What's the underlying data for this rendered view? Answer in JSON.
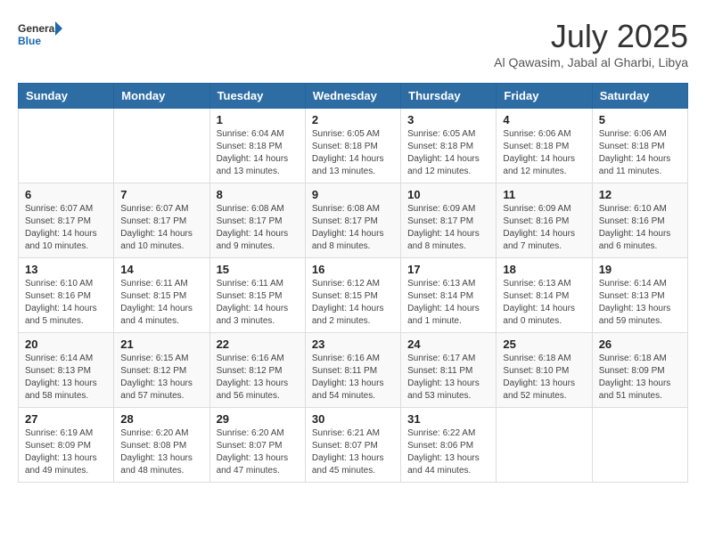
{
  "header": {
    "logo_line1": "General",
    "logo_line2": "Blue",
    "main_title": "July 2025",
    "sub_title": "Al Qawasim, Jabal al Gharbi, Libya"
  },
  "weekdays": [
    "Sunday",
    "Monday",
    "Tuesday",
    "Wednesday",
    "Thursday",
    "Friday",
    "Saturday"
  ],
  "weeks": [
    [
      {
        "day": "",
        "info": ""
      },
      {
        "day": "",
        "info": ""
      },
      {
        "day": "1",
        "info": "Sunrise: 6:04 AM\nSunset: 8:18 PM\nDaylight: 14 hours and 13 minutes."
      },
      {
        "day": "2",
        "info": "Sunrise: 6:05 AM\nSunset: 8:18 PM\nDaylight: 14 hours and 13 minutes."
      },
      {
        "day": "3",
        "info": "Sunrise: 6:05 AM\nSunset: 8:18 PM\nDaylight: 14 hours and 12 minutes."
      },
      {
        "day": "4",
        "info": "Sunrise: 6:06 AM\nSunset: 8:18 PM\nDaylight: 14 hours and 12 minutes."
      },
      {
        "day": "5",
        "info": "Sunrise: 6:06 AM\nSunset: 8:18 PM\nDaylight: 14 hours and 11 minutes."
      }
    ],
    [
      {
        "day": "6",
        "info": "Sunrise: 6:07 AM\nSunset: 8:17 PM\nDaylight: 14 hours and 10 minutes."
      },
      {
        "day": "7",
        "info": "Sunrise: 6:07 AM\nSunset: 8:17 PM\nDaylight: 14 hours and 10 minutes."
      },
      {
        "day": "8",
        "info": "Sunrise: 6:08 AM\nSunset: 8:17 PM\nDaylight: 14 hours and 9 minutes."
      },
      {
        "day": "9",
        "info": "Sunrise: 6:08 AM\nSunset: 8:17 PM\nDaylight: 14 hours and 8 minutes."
      },
      {
        "day": "10",
        "info": "Sunrise: 6:09 AM\nSunset: 8:17 PM\nDaylight: 14 hours and 8 minutes."
      },
      {
        "day": "11",
        "info": "Sunrise: 6:09 AM\nSunset: 8:16 PM\nDaylight: 14 hours and 7 minutes."
      },
      {
        "day": "12",
        "info": "Sunrise: 6:10 AM\nSunset: 8:16 PM\nDaylight: 14 hours and 6 minutes."
      }
    ],
    [
      {
        "day": "13",
        "info": "Sunrise: 6:10 AM\nSunset: 8:16 PM\nDaylight: 14 hours and 5 minutes."
      },
      {
        "day": "14",
        "info": "Sunrise: 6:11 AM\nSunset: 8:15 PM\nDaylight: 14 hours and 4 minutes."
      },
      {
        "day": "15",
        "info": "Sunrise: 6:11 AM\nSunset: 8:15 PM\nDaylight: 14 hours and 3 minutes."
      },
      {
        "day": "16",
        "info": "Sunrise: 6:12 AM\nSunset: 8:15 PM\nDaylight: 14 hours and 2 minutes."
      },
      {
        "day": "17",
        "info": "Sunrise: 6:13 AM\nSunset: 8:14 PM\nDaylight: 14 hours and 1 minute."
      },
      {
        "day": "18",
        "info": "Sunrise: 6:13 AM\nSunset: 8:14 PM\nDaylight: 14 hours and 0 minutes."
      },
      {
        "day": "19",
        "info": "Sunrise: 6:14 AM\nSunset: 8:13 PM\nDaylight: 13 hours and 59 minutes."
      }
    ],
    [
      {
        "day": "20",
        "info": "Sunrise: 6:14 AM\nSunset: 8:13 PM\nDaylight: 13 hours and 58 minutes."
      },
      {
        "day": "21",
        "info": "Sunrise: 6:15 AM\nSunset: 8:12 PM\nDaylight: 13 hours and 57 minutes."
      },
      {
        "day": "22",
        "info": "Sunrise: 6:16 AM\nSunset: 8:12 PM\nDaylight: 13 hours and 56 minutes."
      },
      {
        "day": "23",
        "info": "Sunrise: 6:16 AM\nSunset: 8:11 PM\nDaylight: 13 hours and 54 minutes."
      },
      {
        "day": "24",
        "info": "Sunrise: 6:17 AM\nSunset: 8:11 PM\nDaylight: 13 hours and 53 minutes."
      },
      {
        "day": "25",
        "info": "Sunrise: 6:18 AM\nSunset: 8:10 PM\nDaylight: 13 hours and 52 minutes."
      },
      {
        "day": "26",
        "info": "Sunrise: 6:18 AM\nSunset: 8:09 PM\nDaylight: 13 hours and 51 minutes."
      }
    ],
    [
      {
        "day": "27",
        "info": "Sunrise: 6:19 AM\nSunset: 8:09 PM\nDaylight: 13 hours and 49 minutes."
      },
      {
        "day": "28",
        "info": "Sunrise: 6:20 AM\nSunset: 8:08 PM\nDaylight: 13 hours and 48 minutes."
      },
      {
        "day": "29",
        "info": "Sunrise: 6:20 AM\nSunset: 8:07 PM\nDaylight: 13 hours and 47 minutes."
      },
      {
        "day": "30",
        "info": "Sunrise: 6:21 AM\nSunset: 8:07 PM\nDaylight: 13 hours and 45 minutes."
      },
      {
        "day": "31",
        "info": "Sunrise: 6:22 AM\nSunset: 8:06 PM\nDaylight: 13 hours and 44 minutes."
      },
      {
        "day": "",
        "info": ""
      },
      {
        "day": "",
        "info": ""
      }
    ]
  ]
}
